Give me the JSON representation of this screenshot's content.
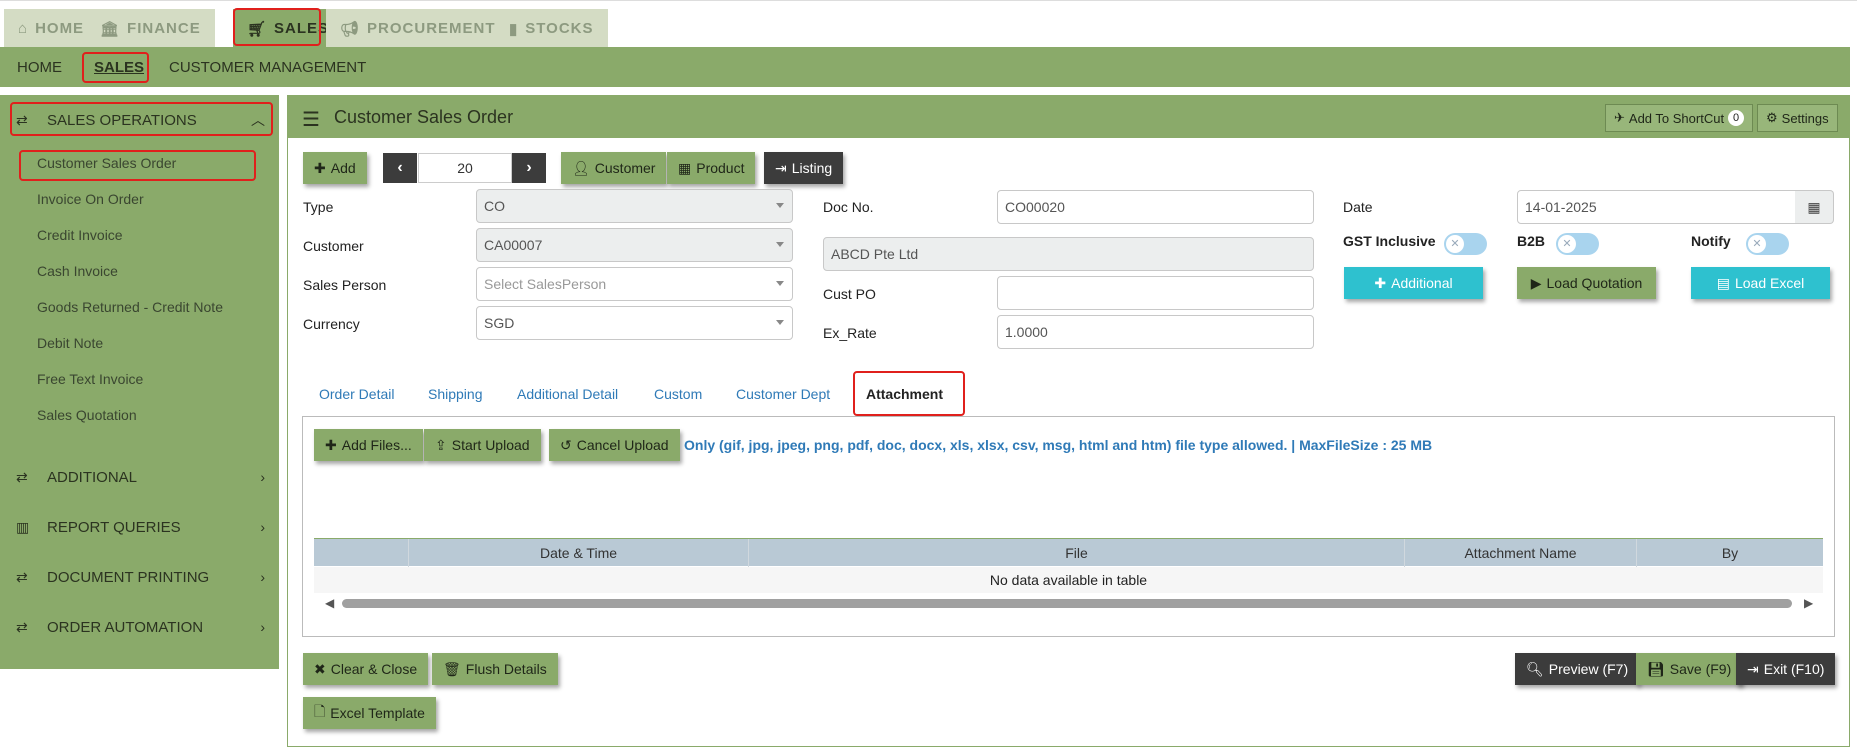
{
  "top_tabs": [
    {
      "label": "HOME",
      "icon": "home-icon"
    },
    {
      "label": "FINANCE",
      "icon": "bank-icon"
    },
    {
      "label": "SALES",
      "icon": "cart-icon"
    },
    {
      "label": "PROCUREMENT",
      "icon": "bullhorn-icon"
    },
    {
      "label": "STOCKS",
      "icon": "bar-chart-icon"
    }
  ],
  "sub_nav": [
    "HOME",
    "SALES",
    "CUSTOMER MANAGEMENT"
  ],
  "sidebar": {
    "sales_operations": "SALES OPERATIONS",
    "items": [
      "Customer Sales Order",
      "Invoice On Order",
      "Credit Invoice",
      "Cash Invoice",
      "Goods Returned - Credit Note",
      "Debit Note",
      "Free Text Invoice",
      "Sales Quotation"
    ],
    "sections": [
      "ADDITIONAL",
      "REPORT QUERIES",
      "DOCUMENT PRINTING",
      "ORDER AUTOMATION"
    ]
  },
  "header": {
    "title": "Customer Sales Order",
    "shortcut_label": "Add To ShortCut",
    "shortcut_count": "0",
    "settings_label": "Settings"
  },
  "toolbar": {
    "add": "Add",
    "page": "20",
    "customer": "Customer",
    "product": "Product",
    "listing": "Listing"
  },
  "form": {
    "type_label": "Type",
    "type_value": "CO",
    "customer_label": "Customer",
    "customer_value": "CA00007",
    "salesperson_label": "Sales Person",
    "salesperson_placeholder": "Select SalesPerson",
    "currency_label": "Currency",
    "currency_value": "SGD",
    "docno_label": "Doc No.",
    "docno_value": "CO00020",
    "customer_name": "ABCD Pte Ltd",
    "custpo_label": "Cust PO",
    "custpo_value": "",
    "exrate_label": "Ex_Rate",
    "exrate_value": "1.0000",
    "date_label": "Date",
    "date_value": "14-01-2025",
    "gst_label": "GST Inclusive",
    "b2b_label": "B2B",
    "notify_label": "Notify",
    "additional_btn": "Additional",
    "load_quotation_btn": "Load Quotation",
    "load_excel_btn": "Load Excel"
  },
  "tabs": [
    "Order Detail",
    "Shipping",
    "Additional Detail",
    "Custom",
    "Customer Dept",
    "Attachment"
  ],
  "attachment": {
    "add_files": "Add Files...",
    "start_upload": "Start Upload",
    "cancel_upload": "Cancel Upload",
    "note": "Only (gif, jpg, jpeg, png, pdf, doc, docx, xls, xlsx, csv, msg, html and htm) file type allowed. | MaxFileSize : 25 MB",
    "columns": [
      "",
      "Date & Time",
      "File",
      "Attachment Name",
      "By"
    ],
    "empty": "No data available in table"
  },
  "footer": {
    "clear_close": "Clear & Close",
    "flush_details": "Flush Details",
    "excel_template": "Excel Template",
    "preview": "Preview (F7)",
    "save": "Save (F9)",
    "exit": "Exit (F10)"
  },
  "colors": {
    "accent_green": "#8aaa6a",
    "highlight_red": "#e0201c",
    "cyan": "#2ec1cf",
    "dark": "#3c3c3c",
    "link_blue": "#2f7ab7"
  }
}
